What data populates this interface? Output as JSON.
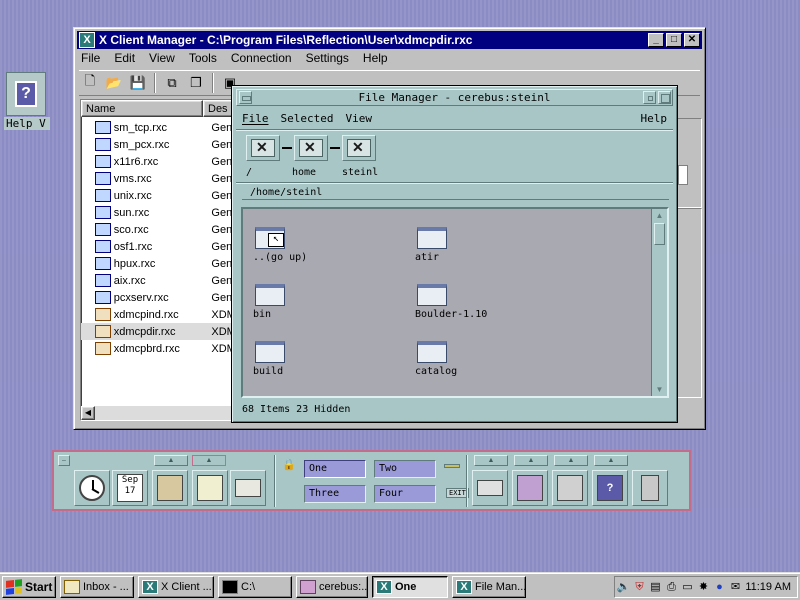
{
  "desktop": {
    "help_icon_label": "Help V"
  },
  "xcm": {
    "title": "X Client Manager - C:\\Program Files\\Reflection\\User\\xdmcpdir.rxc",
    "menu": [
      "File",
      "Edit",
      "View",
      "Tools",
      "Connection",
      "Settings",
      "Help"
    ],
    "columns": {
      "name": "Name",
      "desc": "Des"
    },
    "rows": [
      {
        "name": "sm_tcp.rxc",
        "desc": "Gen",
        "icon": "terminal-icon"
      },
      {
        "name": "sm_pcx.rxc",
        "desc": "Gen",
        "icon": "terminal-icon"
      },
      {
        "name": "x11r6.rxc",
        "desc": "Gen",
        "icon": "terminal-icon"
      },
      {
        "name": "vms.rxc",
        "desc": "Gen",
        "icon": "terminal-icon"
      },
      {
        "name": "unix.rxc",
        "desc": "Gen",
        "icon": "terminal-icon"
      },
      {
        "name": "sun.rxc",
        "desc": "Gen",
        "icon": "terminal-icon"
      },
      {
        "name": "sco.rxc",
        "desc": "Gen",
        "icon": "terminal-icon"
      },
      {
        "name": "osf1.rxc",
        "desc": "Gen",
        "icon": "terminal-icon"
      },
      {
        "name": "hpux.rxc",
        "desc": "Gen",
        "icon": "terminal-icon"
      },
      {
        "name": "aix.rxc",
        "desc": "Gen",
        "icon": "terminal-icon"
      },
      {
        "name": "pcxserv.rxc",
        "desc": "Gen",
        "icon": "terminal-icon"
      },
      {
        "name": "xdmcpind.rxc",
        "desc": "XDM",
        "icon": "network-icon"
      },
      {
        "name": "xdmcpdir.rxc",
        "desc": "XDM",
        "icon": "network-icon"
      },
      {
        "name": "xdmcpbrd.rxc",
        "desc": "XDM",
        "icon": "network-icon"
      }
    ]
  },
  "fm": {
    "title": "File Manager - cerebus:steinl",
    "menu": {
      "file": "File",
      "selected": "Selected",
      "view": "View",
      "help": "Help"
    },
    "path_labels": {
      "root": "/",
      "home": "home",
      "user": "steinl"
    },
    "path": "/home/steinl",
    "items": [
      {
        "label": "..(go up)"
      },
      {
        "label": "atir"
      },
      {
        "label": "bin"
      },
      {
        "label": "Boulder-1.10"
      },
      {
        "label": "build"
      },
      {
        "label": "catalog"
      }
    ],
    "status": "68 Items 23 Hidden"
  },
  "panel": {
    "calendar_month": "Sep",
    "calendar_day": "17",
    "workspaces": [
      "One",
      "Two",
      "Three",
      "Four"
    ],
    "exit_label": "EXIT"
  },
  "taskbar": {
    "start": "Start",
    "buttons": [
      "Inbox - ...",
      "X Client ...",
      "C:\\",
      "cerebus:...",
      "One",
      "File Man..."
    ],
    "clock": "11:19 AM"
  },
  "colors": {
    "desktop": "#8c8cc4",
    "titlebar_active": "#000080",
    "motif_bg": "#a9c6c6",
    "panel_border": "#c46c8c"
  }
}
